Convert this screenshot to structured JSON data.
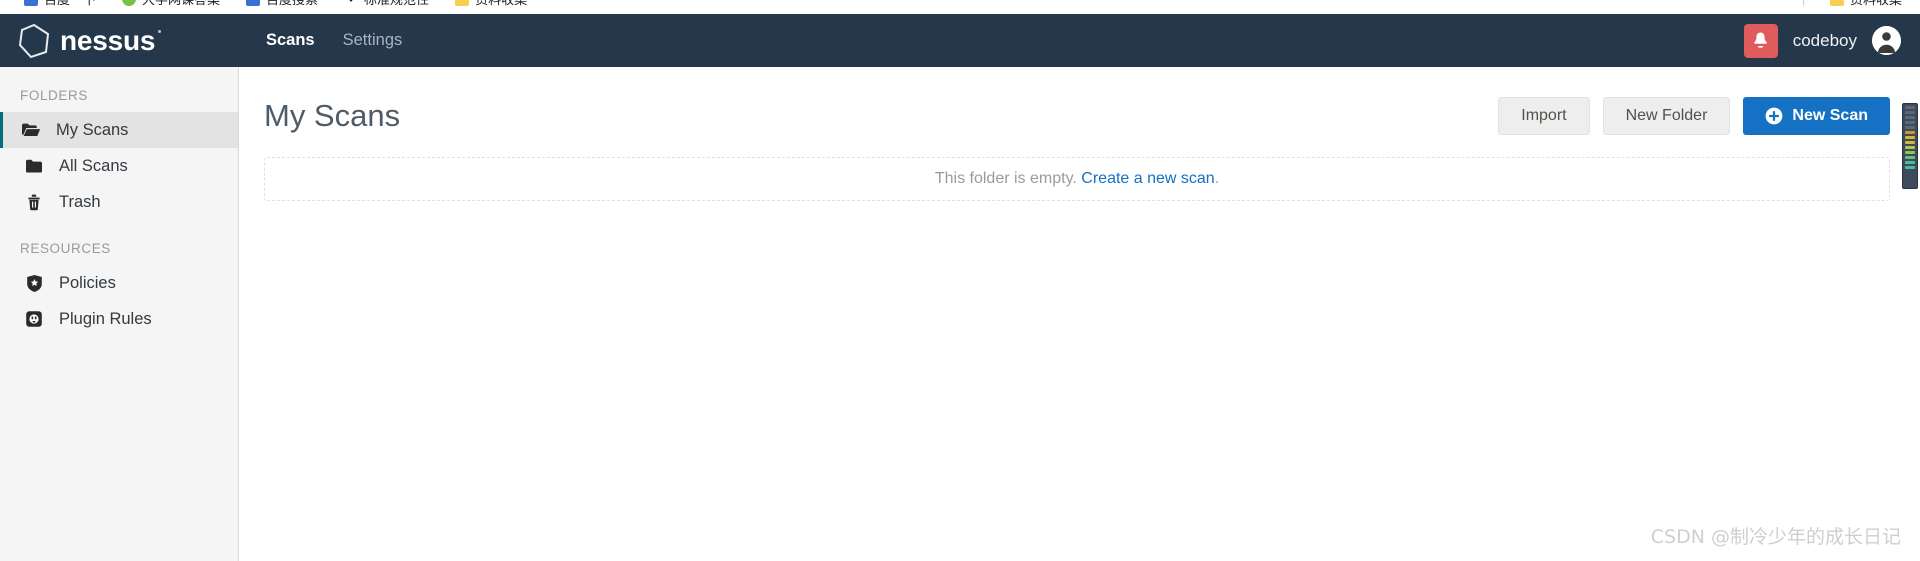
{
  "browser": {
    "bookmarks": [
      {
        "label": "百度一下",
        "icon": "blue-square-icon"
      },
      {
        "label": "大学网课答案",
        "icon": "green-circle-icon"
      },
      {
        "label": "百度搜索",
        "icon": "blue-square-icon"
      },
      {
        "label": "标准规范性",
        "icon": "chevron-down-icon"
      },
      {
        "label": "资料收集",
        "icon": "yellow-folder-icon"
      }
    ],
    "bookmarks_right": [
      {
        "label": "资料收集",
        "icon": "yellow-folder-icon"
      }
    ]
  },
  "topbar": {
    "brand": "nessus",
    "brand_icon": "hexagon-logo-icon",
    "tabs": [
      {
        "label": "Scans",
        "active": true
      },
      {
        "label": "Settings",
        "active": false
      }
    ],
    "notification_icon": "bell-icon",
    "notification_color": "#e05c5c",
    "user_name": "codeboy",
    "avatar_icon": "user-avatar-icon",
    "background": "#25374a"
  },
  "sidebar": {
    "sections": [
      {
        "title": "FOLDERS",
        "items": [
          {
            "label": "My Scans",
            "icon": "folder-open-icon",
            "active": true
          },
          {
            "label": "All Scans",
            "icon": "folder-closed-icon",
            "active": false
          },
          {
            "label": "Trash",
            "icon": "trash-icon",
            "active": false
          }
        ]
      },
      {
        "title": "RESOURCES",
        "items": [
          {
            "label": "Policies",
            "icon": "shield-star-icon",
            "active": false
          },
          {
            "label": "Plugin Rules",
            "icon": "plugin-rules-icon",
            "active": false
          }
        ]
      }
    ],
    "active_accent": "#00707f",
    "background": "#f5f5f5"
  },
  "main": {
    "page_title": "My Scans",
    "actions": {
      "import_label": "Import",
      "new_folder_label": "New Folder",
      "new_scan_label": "New Scan",
      "new_scan_icon": "plus-circle-icon",
      "primary_color": "#1471c4"
    },
    "empty_state": {
      "message": "This folder is empty.",
      "link_label": "Create a new scan",
      "trailing": "."
    }
  },
  "scrollbar": {
    "name": "vertical-scrollbar",
    "tick_colors": [
      "#5b6878",
      "#5b6878",
      "#5b6878",
      "#5b6878",
      "#5b6878",
      "#c9992e",
      "#d8b23a",
      "#cdbb3f",
      "#b9c44a",
      "#8cc455",
      "#63c07a",
      "#4dbd97",
      "#46b9ab"
    ]
  },
  "watermark": {
    "text": "CSDN @制冷少年的成长日记"
  }
}
